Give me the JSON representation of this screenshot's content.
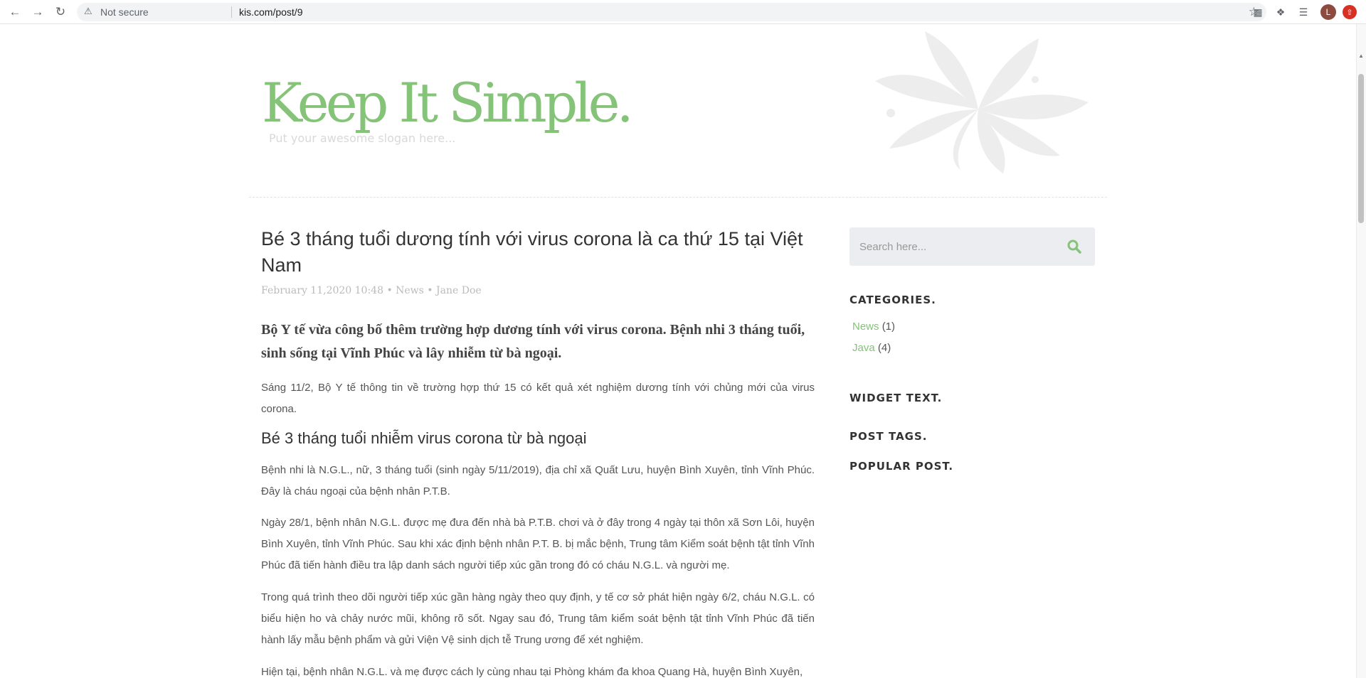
{
  "browser": {
    "security_label": "Not secure",
    "url": "kis.com/post/9",
    "profile_initial": "L"
  },
  "site": {
    "title": "Keep It Simple.",
    "slogan": "Put your awesome slogan here...",
    "accent_color": "#84c378"
  },
  "post": {
    "title": "Bé 3 tháng tuổi dương tính với virus corona là ca thứ 15 tại Việt Nam",
    "meta": "February 11,2020 10:48 • News • Jane Doe",
    "lead": "Bộ Y tế vừa công bố thêm trường hợp dương tính với virus corona. Bệnh nhi 3 tháng tuổi, sinh sống tại Vĩnh Phúc và lây nhiễm từ bà ngoại.",
    "intro": "Sáng 11/2, Bộ Y tế thông tin về trường hợp thứ 15 có kết quả xét nghiệm dương tính với chủng mới của virus corona.",
    "subheading": "Bé 3 tháng tuổi nhiễm virus corona từ bà ngoại",
    "paragraphs": [
      "Bệnh nhi là N.G.L., nữ, 3 tháng tuổi (sinh ngày 5/11/2019), địa chỉ xã Quất Lưu, huyện Bình Xuyên, tỉnh Vĩnh Phúc. Đây là cháu ngoại của bệnh nhân P.T.B.",
      "Ngày 28/1, bệnh nhân N.G.L. được mẹ đưa đến nhà bà P.T.B. chơi và ở đây trong 4 ngày tại thôn xã Sơn Lôi, huyện Bình Xuyên, tỉnh Vĩnh Phúc. Sau khi xác định bệnh nhân P.T. B. bị mắc bệnh, Trung tâm Kiểm soát bệnh tật tỉnh Vĩnh Phúc đã tiến hành điều tra lập danh sách người tiếp xúc gần trong đó có cháu N.G.L. và người mẹ.",
      "Trong quá trình theo dõi người tiếp xúc gần hàng ngày theo quy định, y tế cơ sở phát hiện ngày 6/2, cháu N.G.L. có biểu hiện ho và chảy nước mũi, không rõ sốt. Ngay sau đó, Trung tâm kiểm soát bệnh tật tỉnh Vĩnh Phúc đã tiến hành lấy mẫu bệnh phẩm và gửi Viện Vệ sinh dịch tễ Trung ương để xét nghiệm.",
      "Hiện tại, bệnh nhân N.G.L. và mẹ được cách ly cùng nhau tại Phòng khám đa khoa Quang Hà, huyện Bình Xuyên,"
    ]
  },
  "sidebar": {
    "search_placeholder": "Search here...",
    "categories_title": "CATEGORIES.",
    "categories": [
      {
        "name": "News",
        "count": "(1)"
      },
      {
        "name": "Java",
        "count": "(4)"
      }
    ],
    "widget_text_title": "WIDGET TEXT.",
    "post_tags_title": "POST TAGS.",
    "popular_post_title": "POPULAR POST."
  }
}
